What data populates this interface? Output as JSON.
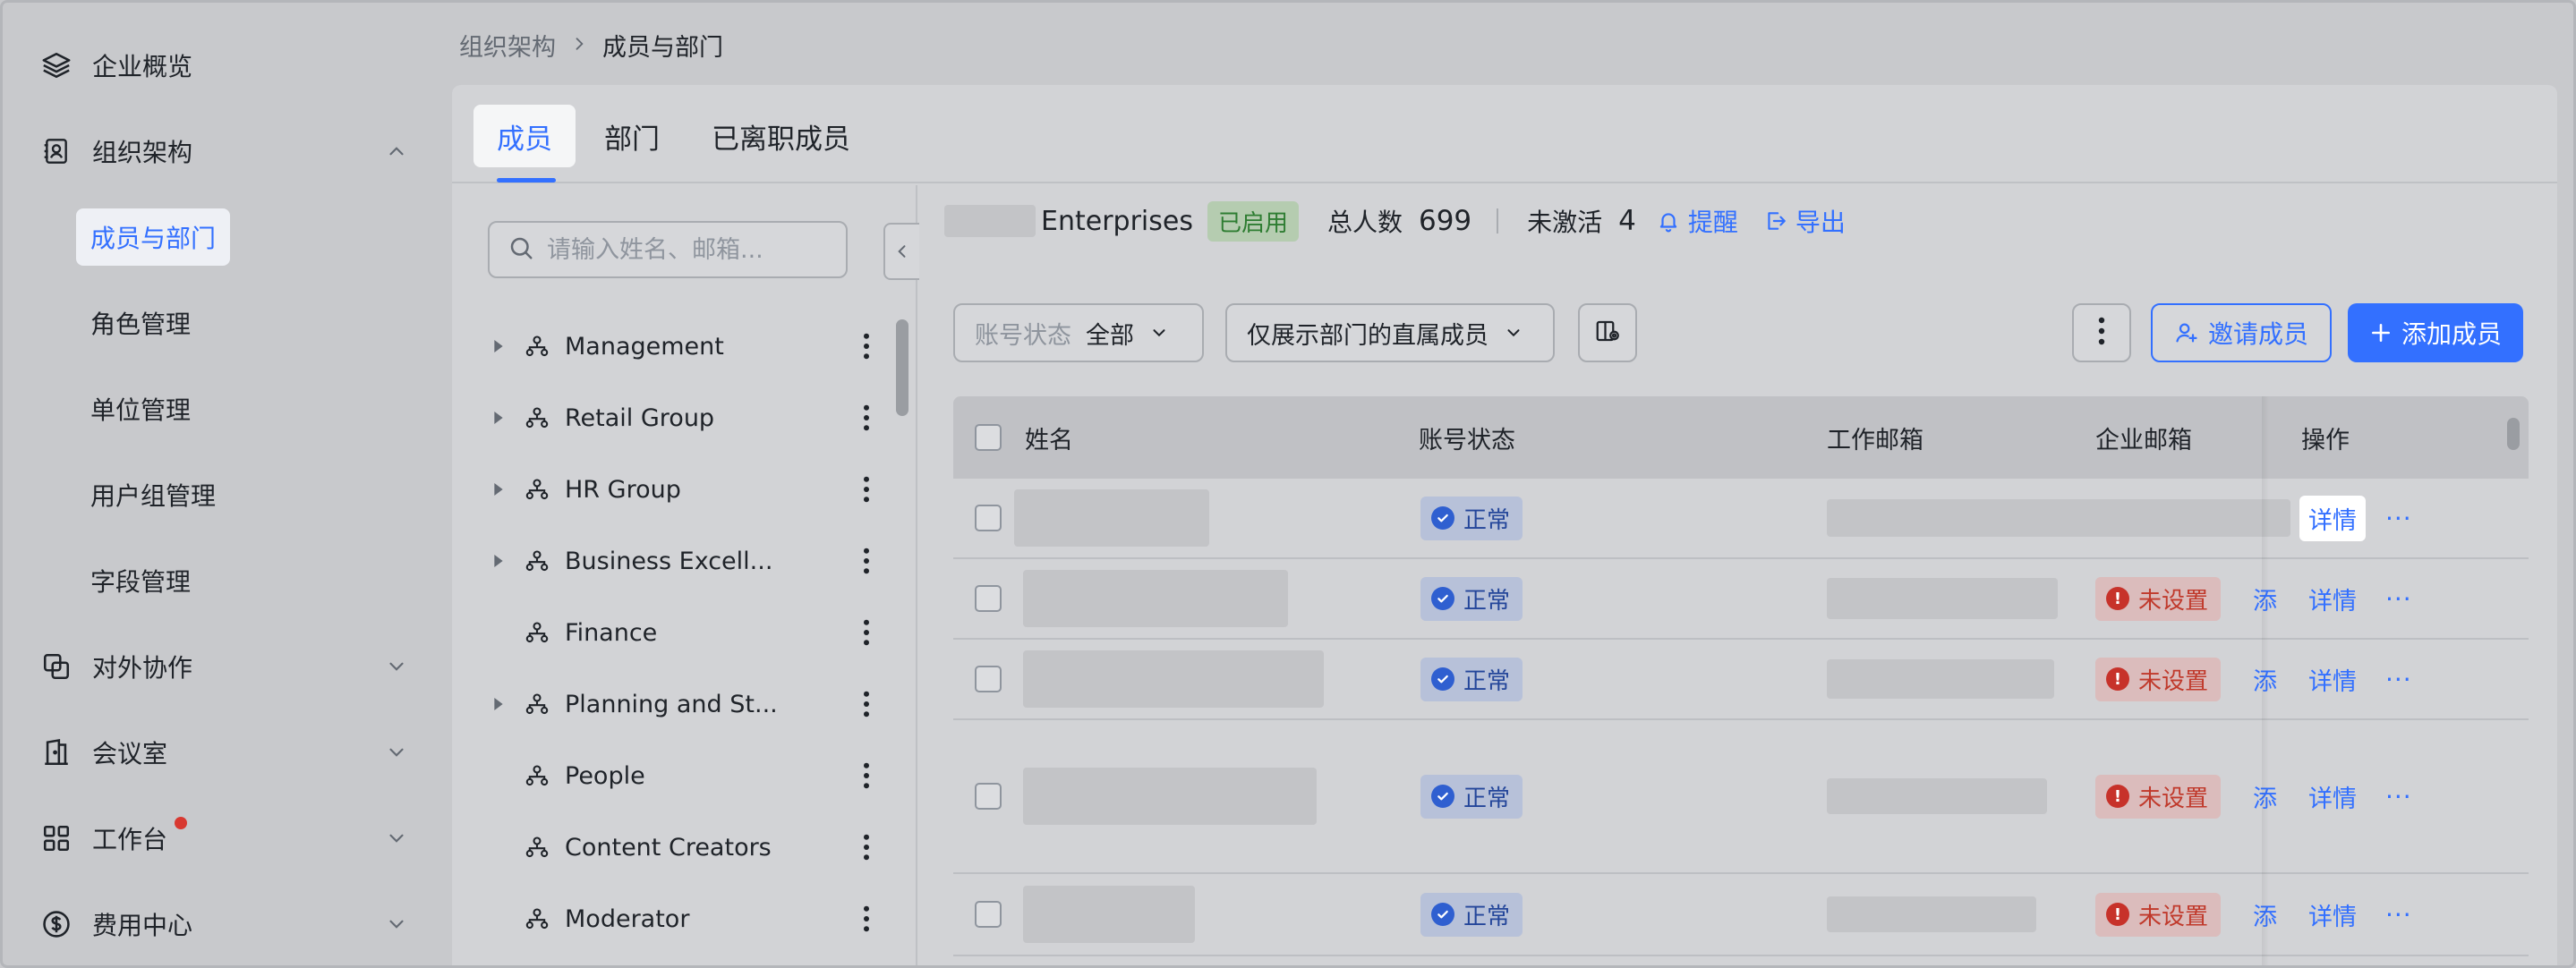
{
  "sidebar": {
    "items": [
      {
        "label": "企业概览",
        "icon": "layers-icon"
      },
      {
        "label": "组织架构",
        "icon": "contacts-book-icon",
        "expanded": true
      },
      {
        "label": "对外协作",
        "icon": "external-collab-icon"
      },
      {
        "label": "会议室",
        "icon": "meeting-room-icon"
      },
      {
        "label": "工作台",
        "icon": "grid-apps-icon",
        "badge": "red-dot"
      },
      {
        "label": "费用中心",
        "icon": "dollar-circle-icon"
      }
    ],
    "sub_items": [
      {
        "label": "成员与部门",
        "selected": true
      },
      {
        "label": "角色管理"
      },
      {
        "label": "单位管理"
      },
      {
        "label": "用户组管理"
      },
      {
        "label": "字段管理"
      }
    ]
  },
  "breadcrumb": {
    "parent": "组织架构",
    "current": "成员与部门"
  },
  "tabs": [
    {
      "label": "成员",
      "active": true
    },
    {
      "label": "部门"
    },
    {
      "label": "已离职成员"
    }
  ],
  "tree": {
    "search_placeholder": "请输入姓名、邮箱...",
    "items": [
      {
        "name": "Management",
        "has_children": true
      },
      {
        "name": "Retail Group",
        "has_children": true
      },
      {
        "name": "HR Group",
        "has_children": true
      },
      {
        "name": "Business Excell...",
        "has_children": true
      },
      {
        "name": "Finance",
        "has_children": false
      },
      {
        "name": "Planning and St...",
        "has_children": true
      },
      {
        "name": "People",
        "has_children": false
      },
      {
        "name": "Content Creators",
        "has_children": false
      },
      {
        "name": "Moderator",
        "has_children": false
      }
    ]
  },
  "summary": {
    "org_name": "Enterprises",
    "status_badge": "已启用",
    "total_label": "总人数",
    "total_value": "699",
    "inactive_label": "未激活",
    "inactive_value": "4",
    "remind_label": "提醒",
    "export_label": "导出"
  },
  "filters": {
    "account_status_prefix": "账号状态",
    "account_status_value": "全部",
    "direct_members_label": "仅展示部门的直属成员",
    "invite_label": "邀请成员",
    "add_label": "添加成员"
  },
  "table": {
    "headers": {
      "name": "姓名",
      "status": "账号状态",
      "work_email": "工作邮箱",
      "ent_email": "企业邮箱",
      "ops": "操作"
    },
    "rows": [
      {
        "status": "正常",
        "ent_email": "",
        "ent_action": "",
        "detail": "详情",
        "more": "···"
      },
      {
        "status": "正常",
        "ent_email": "未设置",
        "ent_action": "添",
        "detail": "详情",
        "more": "···"
      },
      {
        "status": "正常",
        "ent_email": "未设置",
        "ent_action": "添",
        "detail": "详情",
        "more": "···"
      },
      {
        "status": "正常",
        "ent_email": "未设置",
        "ent_action": "添",
        "detail": "详情",
        "more": "···"
      },
      {
        "status": "正常",
        "ent_email": "未设置",
        "ent_action": "添",
        "detail": "详情",
        "more": "···"
      }
    ]
  },
  "colors": {
    "accent": "#3370ff",
    "success": "#2e7d32",
    "danger": "#c7322a",
    "notification_dot": "#d83931"
  }
}
